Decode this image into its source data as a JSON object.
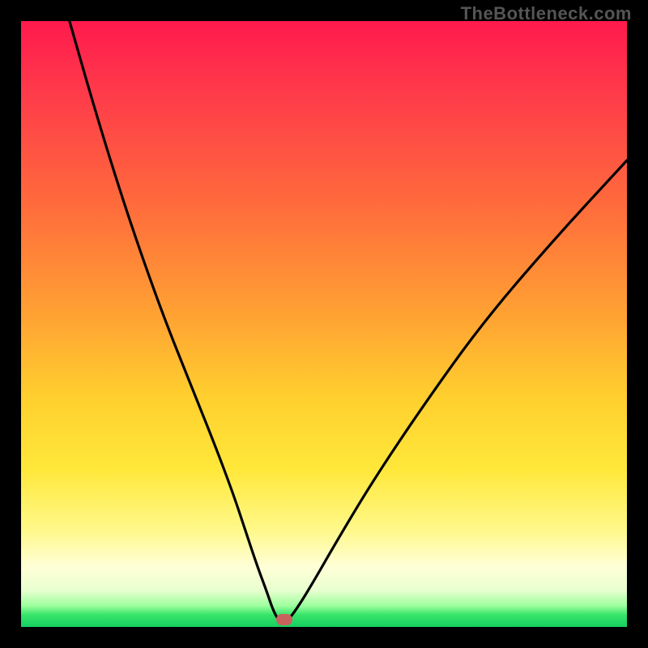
{
  "watermark": "TheBottleneck.com",
  "chart_data": {
    "type": "line",
    "title": "",
    "xlabel": "",
    "ylabel": "",
    "xlim": [
      0,
      100
    ],
    "ylim": [
      0,
      100
    ],
    "note": "Values are visual positions read off the plot: x as fraction of width (0=left,100=right), y as fraction of plot-area height measured from TOP (0=top, 100=bottom).",
    "series": [
      {
        "name": "bottleneck-curve",
        "x": [
          8,
          12,
          16,
          20,
          24,
          28,
          32,
          35,
          37,
          39,
          40.5,
          41.5,
          42.5,
          44,
          45.5,
          48,
          52,
          58,
          66,
          76,
          88,
          100
        ],
        "y": [
          0,
          14,
          27,
          39,
          50,
          60,
          70,
          78,
          84,
          90,
          94,
          97,
          99,
          99,
          97,
          93,
          86,
          76,
          64,
          50,
          36,
          23
        ]
      }
    ],
    "marker": {
      "x_pct": 43.4,
      "y_pct_from_top": 98.8
    },
    "background_gradient_stops": [
      {
        "pct": 0,
        "color": "#ff1a4d"
      },
      {
        "pct": 30,
        "color": "#ff6a3c"
      },
      {
        "pct": 62,
        "color": "#ffcf2e"
      },
      {
        "pct": 90,
        "color": "#ffffd6"
      },
      {
        "pct": 97,
        "color": "#9dff9d"
      },
      {
        "pct": 100,
        "color": "#15d060"
      }
    ]
  }
}
